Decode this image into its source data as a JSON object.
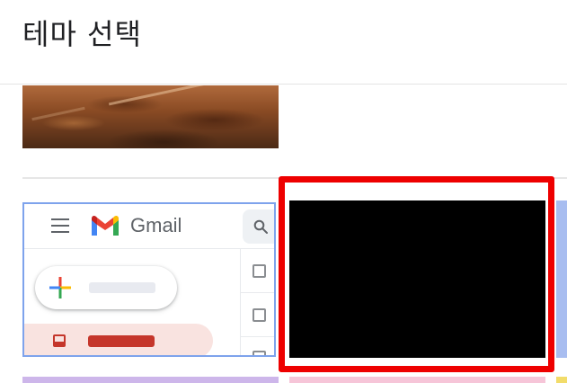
{
  "header": {
    "title": "테마 선택"
  },
  "themes": {
    "gmail_preview": {
      "wordmark": "Gmail"
    }
  },
  "colors": {
    "highlight_border": "#ee0000",
    "selected_tile": "#000000",
    "gmail_tile_border": "#7ea3ec",
    "inbox_accent": "#c5362b"
  },
  "icons": [
    "hamburger-menu-icon",
    "gmail-logo-icon",
    "search-icon",
    "compose-plus-icon",
    "inbox-icon",
    "checkbox-icon"
  ]
}
